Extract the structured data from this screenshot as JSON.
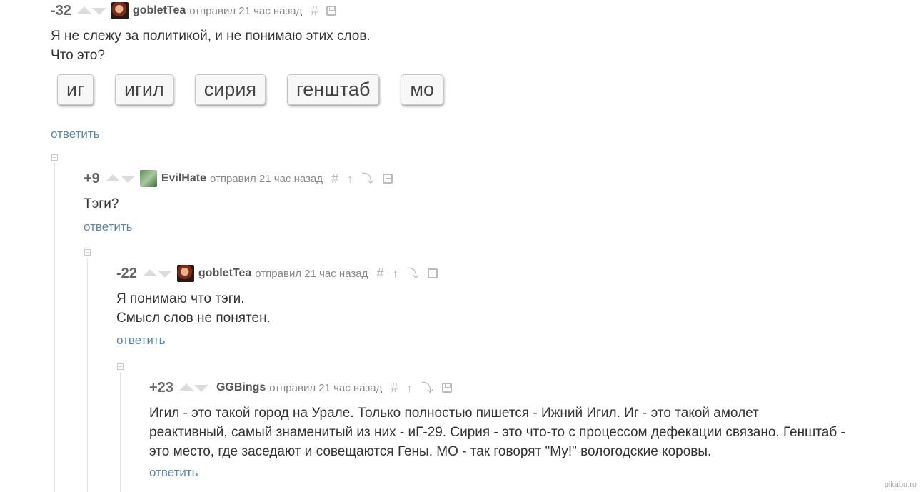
{
  "comment1": {
    "rating": "-32",
    "username": "gobletTea",
    "time": "отправил 21 час назад",
    "body": [
      "Я не слежу за политикой, и не понимаю этих слов.",
      "Что это?"
    ],
    "tags": [
      "иг",
      "игил",
      "сирия",
      "генштаб",
      "мо"
    ],
    "reply": "ответить"
  },
  "comment2": {
    "rating": "+9",
    "username": "EvilHate",
    "time": "отправил 21 час назад",
    "body": [
      "Тэги?"
    ],
    "reply": "ответить"
  },
  "comment3": {
    "rating": "-22",
    "username": "gobletTea",
    "time": "отправил 21 час назад",
    "body": [
      "Я понимаю что тэги.",
      "Смысл слов не понятен."
    ],
    "reply": "ответить"
  },
  "comment4": {
    "rating": "+23",
    "username": "GGBings",
    "time": "отправил 21 час назад",
    "body": [
      "Игил - это такой город на Урале. Только полностью пишется - Ижний Игил. Иг - это такой амолет",
      "реактивный, самый знаменитый из них - иГ-29. Сирия - это что-то с процессом дефекации связано. Генштаб -",
      "это место, где заседают и совещаются Гены. МО - так говорят \"Му!\" вологодские коровы."
    ],
    "reply": "ответить"
  },
  "icons": {
    "hash": "#",
    "arrow_up": "↑",
    "branch": "⤵"
  },
  "watermark": "pikabu.ru"
}
